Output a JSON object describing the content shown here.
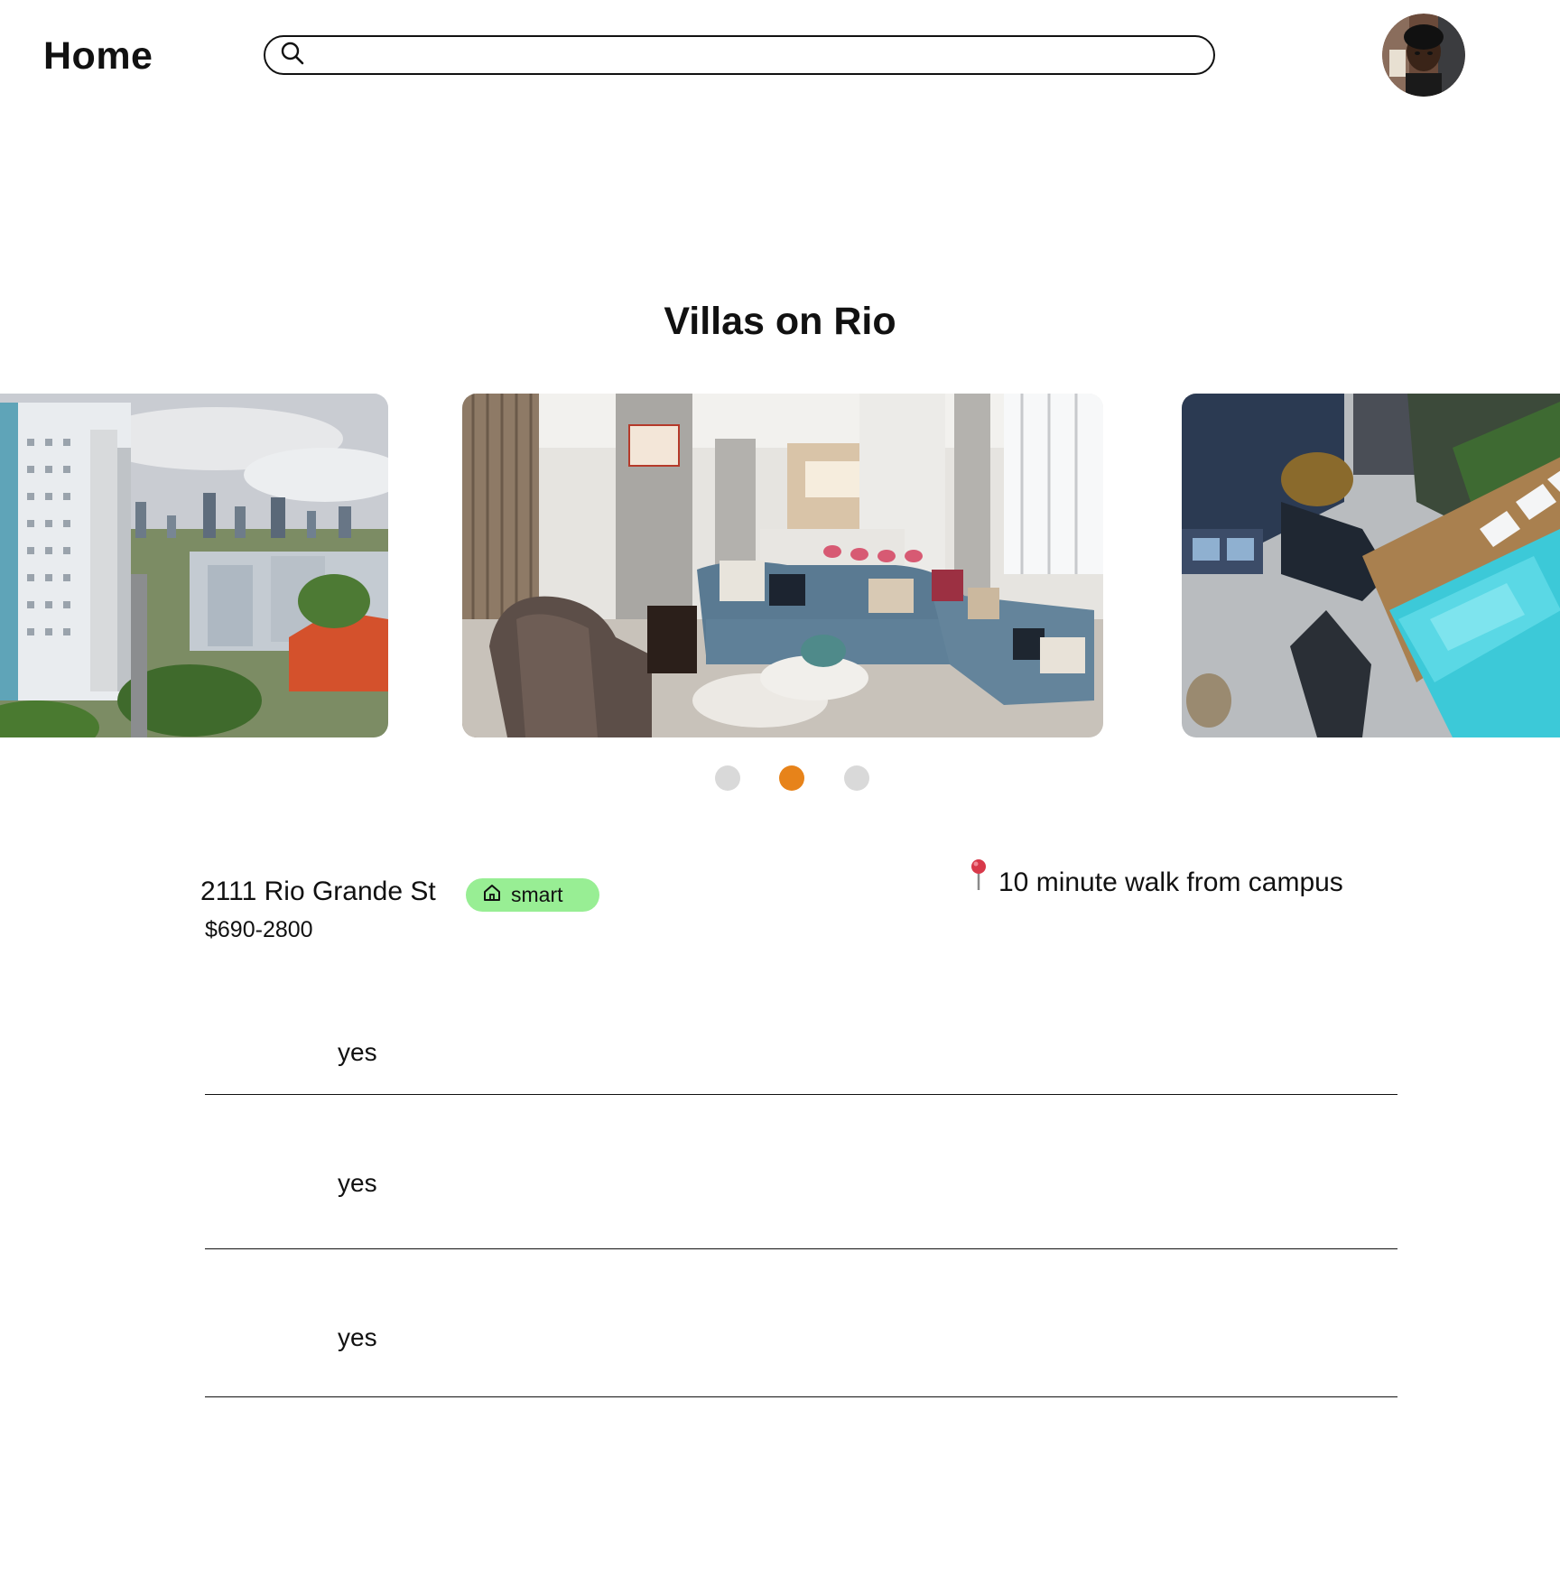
{
  "header": {
    "title": "Home",
    "search": {
      "value": "",
      "placeholder": ""
    }
  },
  "icons": {
    "search": "search-icon",
    "avatar": "user-avatar",
    "smart": "home-icon",
    "location": "map-pin-icon"
  },
  "property": {
    "name": "Villas on Rio",
    "address": "2111 Rio Grande St",
    "badge": "smart",
    "price": "$690-2800",
    "distance": "10 minute walk from campus"
  },
  "carousel": {
    "slides": [
      "city-skyline-photo",
      "lounge-interior-photo",
      "rooftop-pool-photo"
    ],
    "active_index": 1,
    "count": 3
  },
  "features": [
    {
      "value": "yes"
    },
    {
      "value": "yes"
    },
    {
      "value": "yes"
    }
  ],
  "colors": {
    "accent": "#e7831a",
    "dot_inactive": "#d9d9d9",
    "badge_bg": "#98ee94",
    "text": "#111111"
  }
}
